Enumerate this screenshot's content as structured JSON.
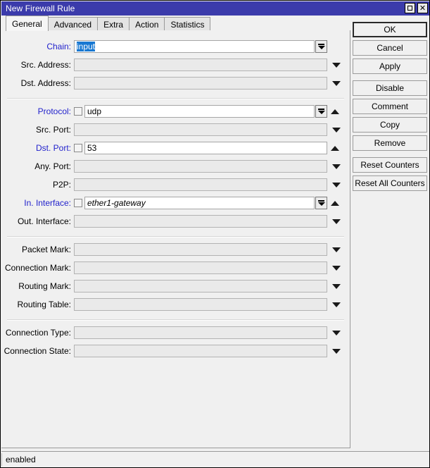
{
  "window": {
    "title": "New Firewall Rule",
    "restore_label": "□",
    "close_label": "✕",
    "accent_titlebar": "#3b3bab",
    "accent_selection": "#1878d2",
    "accent_link_label": "#2222cc"
  },
  "tabs": [
    {
      "label": "General",
      "active": true
    },
    {
      "label": "Advanced",
      "active": false
    },
    {
      "label": "Extra",
      "active": false
    },
    {
      "label": "Action",
      "active": false
    },
    {
      "label": "Statistics",
      "active": false
    }
  ],
  "form": {
    "groups": [
      {
        "rows": [
          {
            "label": "Chain:",
            "label_color": "blue",
            "value": "input",
            "selected": true,
            "checkbox": false,
            "control": "dropdown-box",
            "negate": false,
            "disabled": false,
            "italic": false
          },
          {
            "label": "Src. Address:",
            "label_color": "black",
            "value": "",
            "selected": false,
            "checkbox": false,
            "control": "arrow",
            "negate": false,
            "disabled": true,
            "italic": false
          },
          {
            "label": "Dst. Address:",
            "label_color": "black",
            "value": "",
            "selected": false,
            "checkbox": false,
            "control": "arrow",
            "negate": false,
            "disabled": true,
            "italic": false
          }
        ]
      },
      {
        "rows": [
          {
            "label": "Protocol:",
            "label_color": "blue",
            "value": "udp",
            "selected": false,
            "checkbox": true,
            "control": "dropdown-box",
            "negate": true,
            "disabled": false,
            "italic": false
          },
          {
            "label": "Src. Port:",
            "label_color": "black",
            "value": "",
            "selected": false,
            "checkbox": false,
            "control": "arrow",
            "negate": false,
            "disabled": true,
            "italic": false
          },
          {
            "label": "Dst. Port:",
            "label_color": "blue",
            "value": "53",
            "selected": false,
            "checkbox": true,
            "control": "none",
            "negate": true,
            "disabled": false,
            "italic": false
          },
          {
            "label": "Any. Port:",
            "label_color": "black",
            "value": "",
            "selected": false,
            "checkbox": false,
            "control": "arrow",
            "negate": false,
            "disabled": true,
            "italic": false
          },
          {
            "label": "P2P:",
            "label_color": "black",
            "value": "",
            "selected": false,
            "checkbox": false,
            "control": "arrow",
            "negate": false,
            "disabled": true,
            "italic": false
          },
          {
            "label": "In. Interface:",
            "label_color": "blue",
            "value": "ether1-gateway",
            "selected": false,
            "checkbox": true,
            "control": "dropdown-box",
            "negate": true,
            "disabled": false,
            "italic": true
          },
          {
            "label": "Out. Interface:",
            "label_color": "black",
            "value": "",
            "selected": false,
            "checkbox": false,
            "control": "arrow",
            "negate": false,
            "disabled": true,
            "italic": false
          }
        ]
      },
      {
        "rows": [
          {
            "label": "Packet Mark:",
            "label_color": "black",
            "value": "",
            "selected": false,
            "checkbox": false,
            "control": "arrow",
            "negate": false,
            "disabled": true,
            "italic": false
          },
          {
            "label": "Connection Mark:",
            "label_color": "black",
            "value": "",
            "selected": false,
            "checkbox": false,
            "control": "arrow",
            "negate": false,
            "disabled": true,
            "italic": false
          },
          {
            "label": "Routing Mark:",
            "label_color": "black",
            "value": "",
            "selected": false,
            "checkbox": false,
            "control": "arrow",
            "negate": false,
            "disabled": true,
            "italic": false
          },
          {
            "label": "Routing Table:",
            "label_color": "black",
            "value": "",
            "selected": false,
            "checkbox": false,
            "control": "arrow",
            "negate": false,
            "disabled": true,
            "italic": false
          }
        ]
      },
      {
        "rows": [
          {
            "label": "Connection Type:",
            "label_color": "black",
            "value": "",
            "selected": false,
            "checkbox": false,
            "control": "arrow",
            "negate": false,
            "disabled": true,
            "italic": false
          },
          {
            "label": "Connection State:",
            "label_color": "black",
            "value": "",
            "selected": false,
            "checkbox": false,
            "control": "arrow",
            "negate": false,
            "disabled": true,
            "italic": false
          }
        ]
      }
    ]
  },
  "buttons": [
    {
      "label": "OK",
      "primary": true,
      "gap": false
    },
    {
      "label": "Cancel",
      "primary": false,
      "gap": false
    },
    {
      "label": "Apply",
      "primary": false,
      "gap": false
    },
    {
      "label": "Disable",
      "primary": false,
      "gap": true
    },
    {
      "label": "Comment",
      "primary": false,
      "gap": false
    },
    {
      "label": "Copy",
      "primary": false,
      "gap": false
    },
    {
      "label": "Remove",
      "primary": false,
      "gap": false
    },
    {
      "label": "Reset Counters",
      "primary": false,
      "gap": true
    },
    {
      "label": "Reset All Counters",
      "primary": false,
      "gap": false
    }
  ],
  "statusbar": {
    "text": "enabled"
  }
}
